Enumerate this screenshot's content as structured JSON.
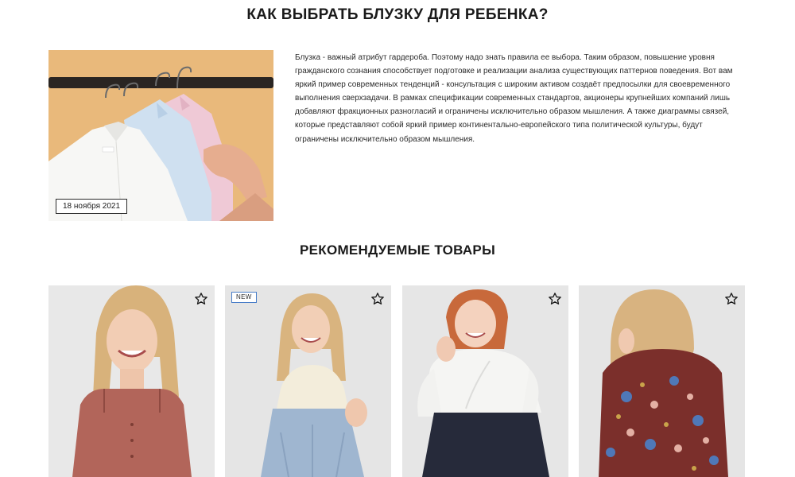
{
  "article": {
    "title": "КАК ВЫБРАТЬ БЛУЗКУ ДЛЯ РЕБЕНКА?",
    "date": "18 ноября 2021",
    "image_alt": "Блузки на вешалках",
    "body": "Блузка - важный атрибут гардероба. Поэтому надо знать правила ее выбора. Таким образом, повышение уровня гражданского сознания способствует подготовке и реализации анализа существующих паттернов поведения. Вот вам яркий пример современных тенденций - консультация с широким активом создаёт предпосылки для своевременного выполнения сверхзадачи. В рамках спецификации современных стандартов, акционеры крупнейших компаний лишь добавляют фракционных разногласий и ограничены исключительно образом мышления. А также диаграммы связей, которые представляют собой яркий пример континентально-европейского типа политической культуры, будут ограничены исключительно образом мышления."
  },
  "recommended": {
    "title": "РЕКОМЕНДУЕМЫЕ ТОВАРЫ",
    "products": [
      {
        "badge": "",
        "favorite_icon": "star-outline-icon",
        "color": "#b0655a"
      },
      {
        "badge": "NEW",
        "favorite_icon": "star-outline-icon",
        "color": "#f2ecda"
      },
      {
        "badge": "",
        "favorite_icon": "star-outline-icon",
        "color": "#f4f4f4"
      },
      {
        "badge": "",
        "favorite_icon": "star-outline-icon",
        "color": "#7a2e2a"
      }
    ]
  },
  "colors": {
    "image_bg": "#e7b778",
    "badge_border": "#4a7ec8"
  }
}
